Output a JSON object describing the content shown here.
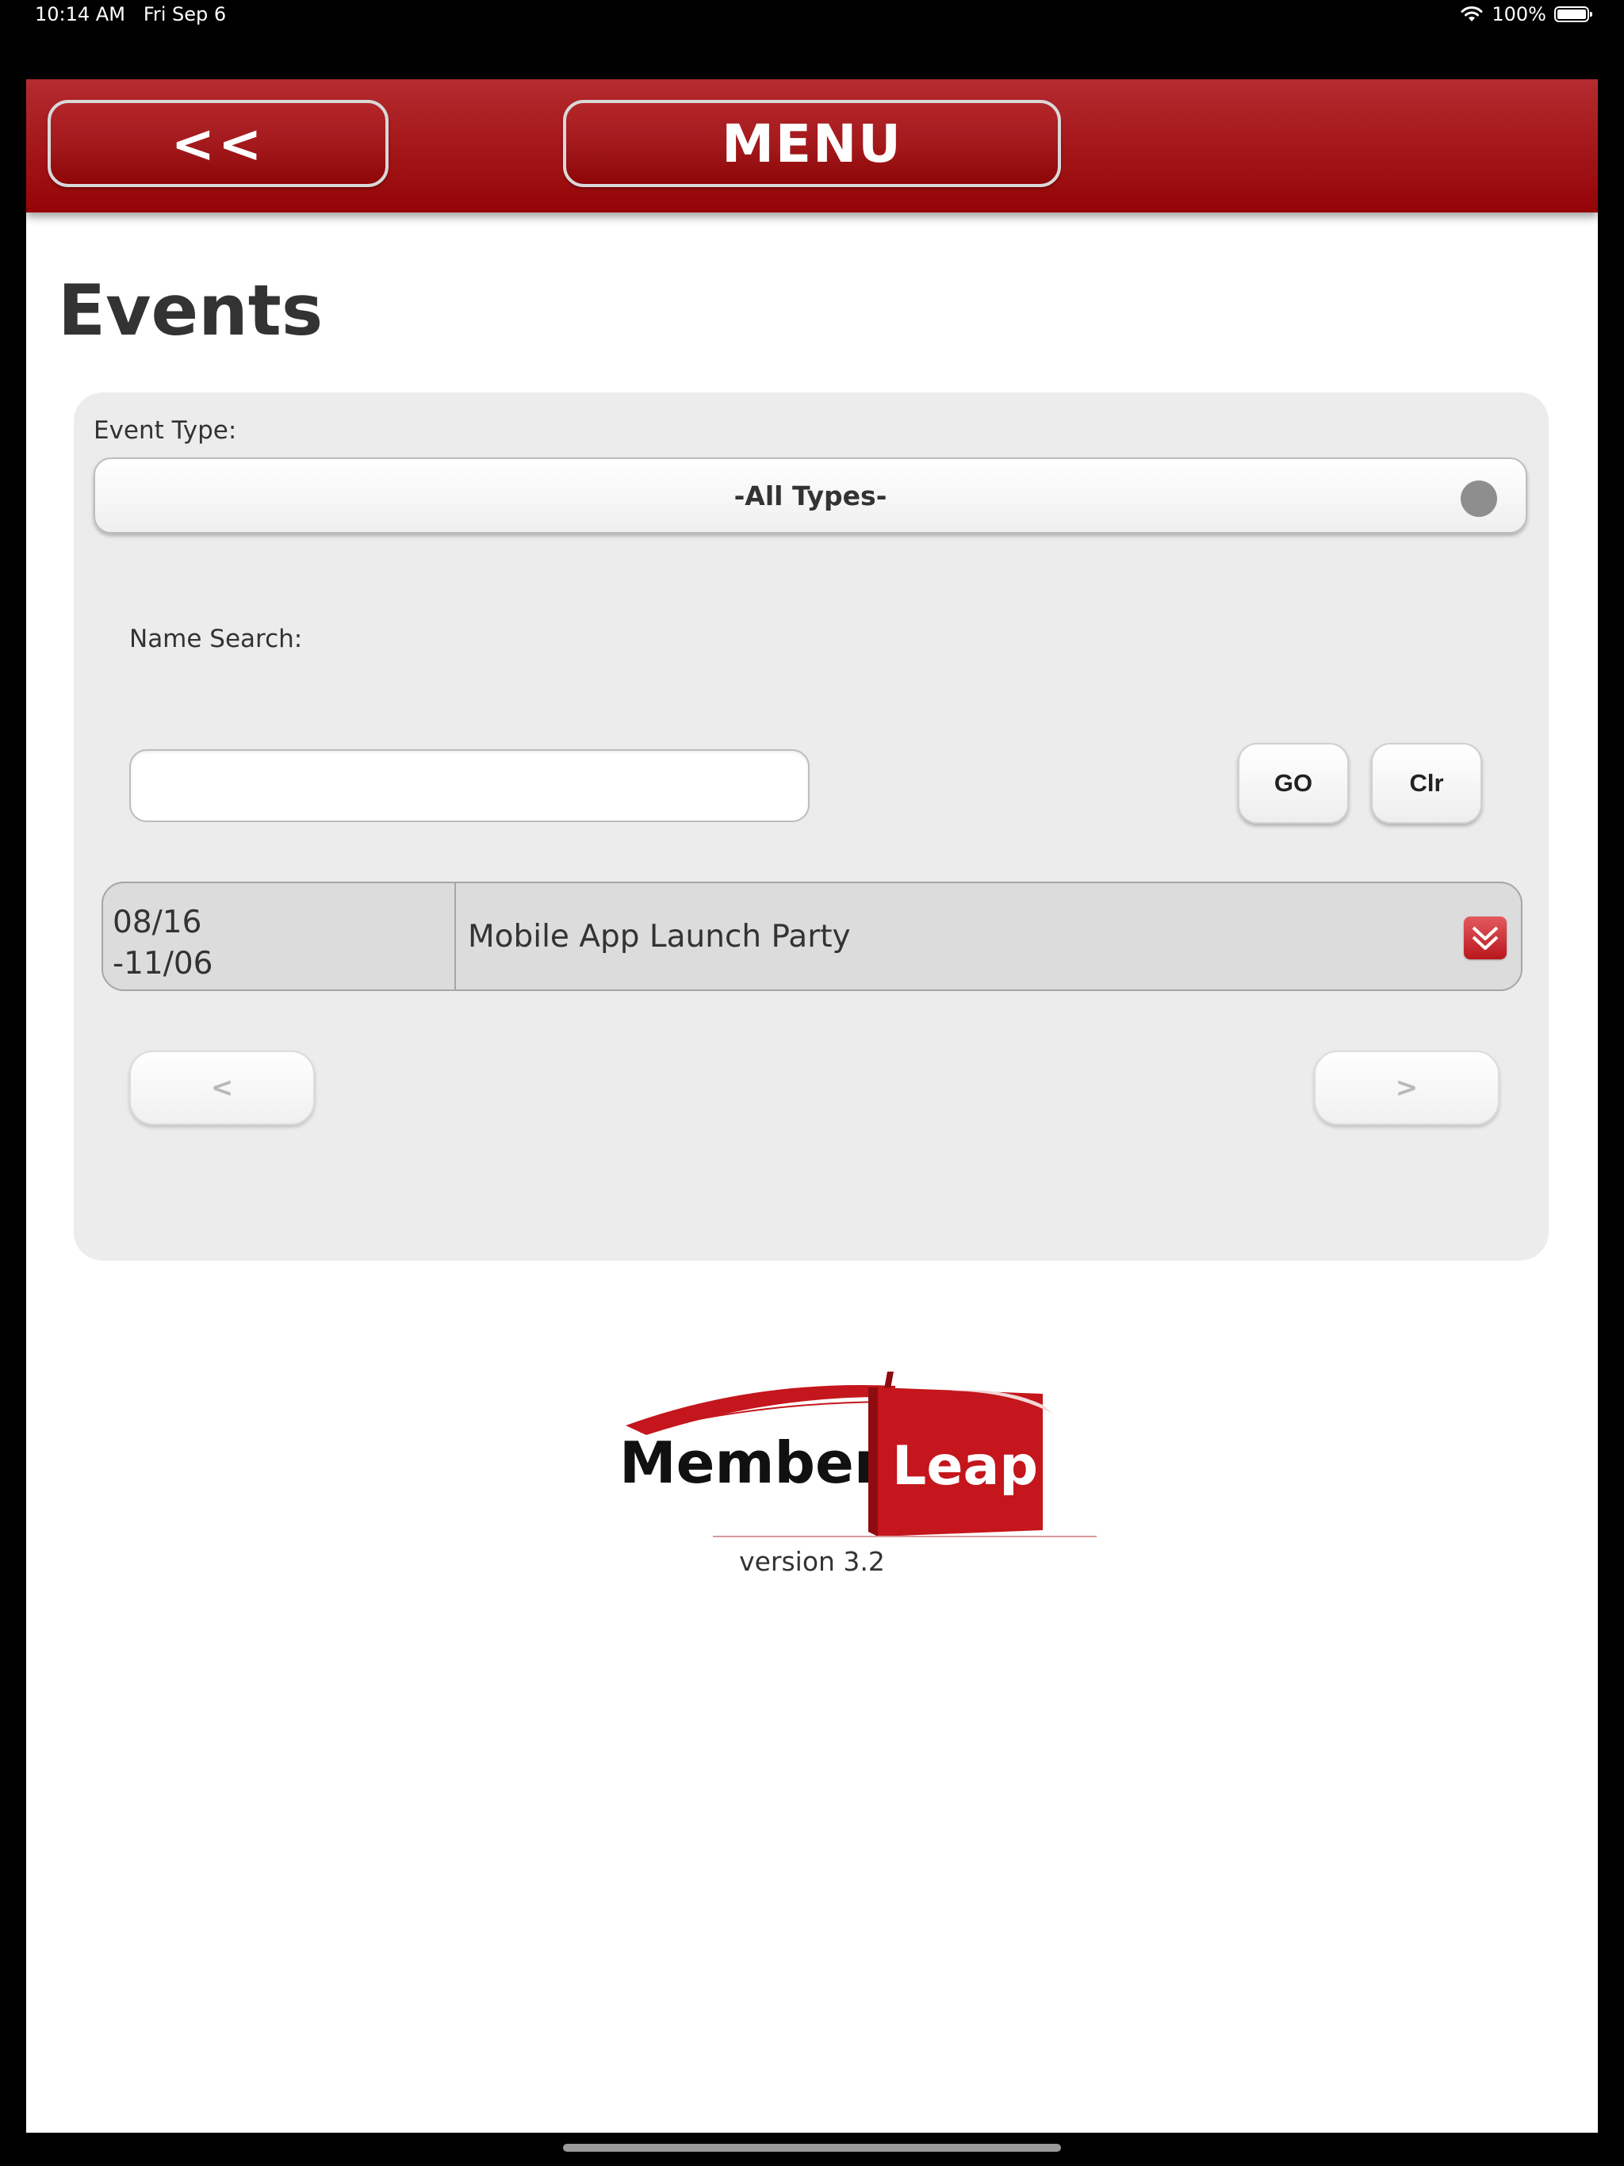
{
  "status_bar": {
    "time": "10:14 AM",
    "date": "Fri Sep 6",
    "battery": "100%"
  },
  "header": {
    "back_label": "<<",
    "menu_label": "MENU"
  },
  "page": {
    "title": "Events"
  },
  "filters": {
    "event_type_label": "Event Type:",
    "event_type_value": "-All Types-",
    "name_search_label": "Name Search:",
    "name_search_value": "",
    "go_label": "GO",
    "clear_label": "Clr"
  },
  "events": [
    {
      "date_start": "08/16",
      "date_end": "-11/06",
      "name": "Mobile App Launch Party"
    }
  ],
  "pagination": {
    "prev_label": "<",
    "next_label": ">"
  },
  "branding": {
    "logo_word_1": "Member",
    "logo_word_2": "Leap",
    "version": "version 3.2",
    "brand_color": "#c4161c"
  }
}
